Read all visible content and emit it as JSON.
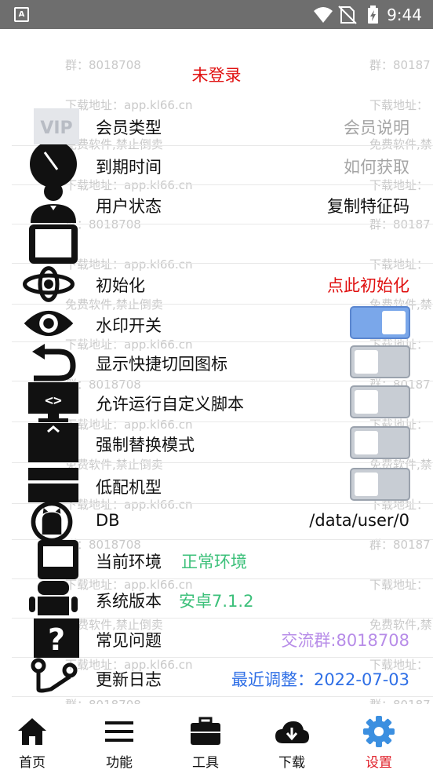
{
  "status_bar": {
    "app_badge": "A",
    "time": "9:44"
  },
  "watermarks": {
    "group": "群：8018708",
    "group_cut": "群：80187",
    "download": "下载地址：app.kl66.cn",
    "download_cut": "下载地址：",
    "free": "免费软件,禁止倒卖",
    "free_cut": "免费软件,禁"
  },
  "header": {
    "login_status": "未登录"
  },
  "rows": {
    "member_type": {
      "label": "会员类型",
      "value": "会员说明"
    },
    "expire": {
      "label": "到期时间",
      "value": "如何获取"
    },
    "user_status": {
      "label": "用户状态",
      "value": "复制特征码"
    },
    "init": {
      "label": "初始化",
      "value": "点此初始化"
    },
    "watermark_switch": {
      "label": "水印开关",
      "on": true
    },
    "shortcut_icon": {
      "label": "显示快捷切回图标",
      "on": false
    },
    "custom_script": {
      "label": "允许运行自定义脚本",
      "on": false
    },
    "force_replace": {
      "label": "强制替换模式",
      "on": false
    },
    "low_device": {
      "label": "低配机型",
      "on": false
    },
    "db": {
      "label": "DB",
      "value": "/data/user/0"
    },
    "environment": {
      "label": "当前环境",
      "value": "正常环境"
    },
    "system_version": {
      "label": "系统版本",
      "value": "安卓7.1.2"
    },
    "faq": {
      "label": "常见问题",
      "value": "交流群:8018708"
    },
    "changelog": {
      "label": "更新日志",
      "value": "最近调整：2022-07-03"
    }
  },
  "vip_badge": "VIP",
  "tabs": [
    {
      "label": "首页"
    },
    {
      "label": "功能"
    },
    {
      "label": "工具"
    },
    {
      "label": "下载"
    },
    {
      "label": "设置"
    }
  ],
  "colors": {
    "accent_blue": "#3b8fe0",
    "active_tab": "#e0202a",
    "init_red": "#e01010",
    "env_green": "#3cc07a",
    "faq_purple": "#b78ce8",
    "date_blue": "#2f6fe6"
  }
}
